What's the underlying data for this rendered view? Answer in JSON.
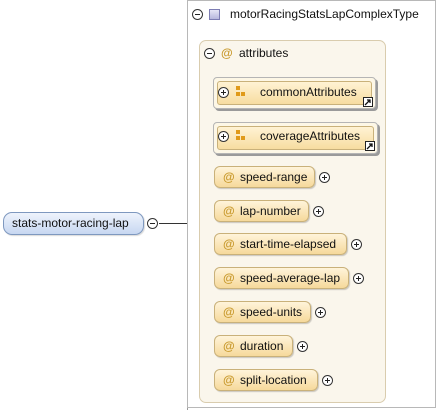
{
  "element": {
    "name": "stats-motor-racing-lap"
  },
  "complex_type": {
    "name": "motorRacingStatsLapComplexType",
    "icon": "complex-type-icon"
  },
  "attributes_group": {
    "title": "attributes",
    "symbol": "@",
    "groups": [
      {
        "name": "commonAttributes",
        "icon": "attribute-group-icon"
      },
      {
        "name": "coverageAttributes",
        "icon": "attribute-group-icon"
      }
    ],
    "items": [
      {
        "name": "speed-range"
      },
      {
        "name": "lap-number"
      },
      {
        "name": "start-time-elapsed"
      },
      {
        "name": "speed-average-lap"
      },
      {
        "name": "speed-units"
      },
      {
        "name": "duration"
      },
      {
        "name": "split-location"
      }
    ]
  },
  "colors": {
    "element_fill": "#c7d7f1",
    "attribute_fill": "#f6d99b",
    "attribute_symbol": "#c99a2e"
  }
}
